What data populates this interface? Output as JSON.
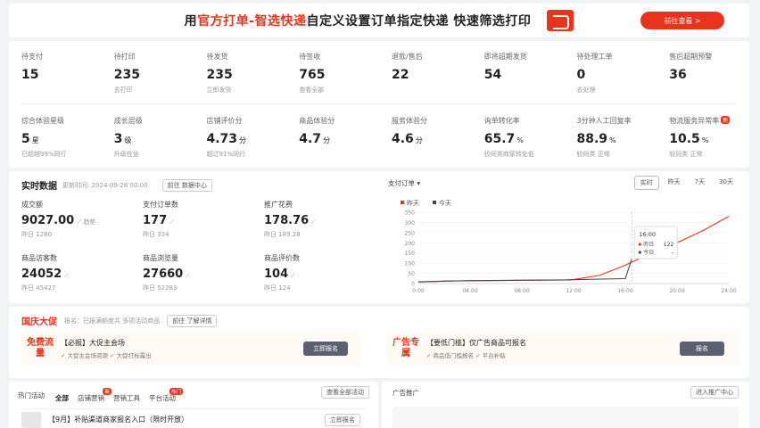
{
  "banner": {
    "part1": "用",
    "part2": "官方打单-智选快递",
    "part3": "自定义设置订单指定快递 快速筛选打印",
    "button": "前往查看 >"
  },
  "orders": [
    {
      "label": "待支付",
      "value": "15",
      "sub": ""
    },
    {
      "label": "待打印",
      "value": "235",
      "sub": "去打印"
    },
    {
      "label": "待发货",
      "value": "235",
      "sub": "立即发货"
    },
    {
      "label": "待签收",
      "value": "765",
      "sub": "查看全部"
    },
    {
      "label": "退款/售后",
      "value": "22",
      "sub": ""
    },
    {
      "label": "即将超期发货",
      "value": "54",
      "sub": ""
    },
    {
      "label": "待处理工单",
      "value": "0",
      "sub": "去处理"
    },
    {
      "label": "售后超期预警",
      "value": "36",
      "sub": ""
    }
  ],
  "scores": [
    {
      "label": "综合体验星级",
      "value": "5",
      "unit": "星",
      "sub": "已超越99%同行",
      "badge": ""
    },
    {
      "label": "成长层级",
      "value": "3",
      "unit": "级",
      "sub": "升级在途",
      "badge": ""
    },
    {
      "label": "店铺评价分",
      "value": "4.73",
      "unit": "分",
      "sub": "超过91%同行",
      "badge": ""
    },
    {
      "label": "商品体验分",
      "value": "4.7",
      "unit": "分",
      "sub": "",
      "badge": ""
    },
    {
      "label": "服务体验分",
      "value": "4.6",
      "unit": "分",
      "sub": "",
      "badge": ""
    },
    {
      "label": "询单转化率",
      "value": "65.7",
      "unit": "%",
      "sub": "较同类商家转化低",
      "badge": ""
    },
    {
      "label": "3分钟人工回复率",
      "value": "88.9",
      "unit": "%",
      "sub": "较同类 正常",
      "badge": ""
    },
    {
      "label": "物流服务异常率",
      "value": "10.5",
      "unit": "%",
      "sub": "较同类 正常",
      "badge": "新"
    }
  ],
  "realtime": {
    "title": "实时数据",
    "updated": "更新时间: 2024-09-28 00:00",
    "export_btn": "前往 数据中心",
    "metrics": [
      {
        "label": "成交额",
        "value": "9027.00",
        "trend": "趋势",
        "sub": "昨日 1280"
      },
      {
        "label": "支付订单数",
        "value": "177",
        "trend": "",
        "sub": "昨日 334"
      },
      {
        "label": "推广花费",
        "value": "178.76",
        "trend": "",
        "sub": "昨日 189.28"
      },
      {
        "label": "商品访客数",
        "value": "24052",
        "trend": "",
        "sub": "昨日 45427"
      },
      {
        "label": "商品浏览量",
        "value": "27660",
        "trend": "",
        "sub": "昨日 52283"
      },
      {
        "label": "商品评价数",
        "value": "104",
        "trend": "",
        "sub": "昨日 124"
      }
    ]
  },
  "chart_select": "支付订单",
  "range_tabs": [
    "实时",
    "昨天",
    "7天",
    "30天"
  ],
  "chart_data": {
    "type": "line",
    "x_ticks": [
      "0:00",
      "04:00",
      "08:00",
      "12:00",
      "16:00",
      "20:00",
      "24:00"
    ],
    "y_ticks": [
      "350",
      "300",
      "250",
      "200",
      "150",
      "100",
      "50",
      "0"
    ],
    "ylim": [
      0,
      350
    ],
    "series": [
      {
        "name": "昨天",
        "color": "#e8341c",
        "points": [
          [
            0,
            8
          ],
          [
            2,
            12
          ],
          [
            4,
            14
          ],
          [
            6,
            15
          ],
          [
            8,
            16
          ],
          [
            10,
            17
          ],
          [
            11.5,
            18
          ],
          [
            12,
            20
          ],
          [
            14,
            40
          ],
          [
            16,
            90
          ],
          [
            18,
            150
          ],
          [
            20,
            200
          ],
          [
            22,
            260
          ],
          [
            24,
            330
          ]
        ]
      },
      {
        "name": "今天",
        "color": "#444444",
        "points": [
          [
            0,
            8
          ],
          [
            2,
            12
          ],
          [
            4,
            14
          ],
          [
            6,
            15
          ],
          [
            8,
            16
          ],
          [
            10,
            17
          ],
          [
            11.5,
            18
          ],
          [
            12,
            19
          ],
          [
            14,
            22
          ],
          [
            16,
            24
          ],
          [
            16.5,
            122
          ]
        ]
      }
    ],
    "tooltip": {
      "title": "16:00",
      "rows": [
        {
          "name": "昨日",
          "value": "122"
        },
        {
          "name": "今日",
          "value": "-"
        }
      ]
    }
  },
  "activity": {
    "title": "国庆大促",
    "desc": "报名：已报满额度共 多项活动商品",
    "link": "前往 了解详情",
    "items": [
      {
        "tag": "免费流量",
        "head": "【必报】大促主会场",
        "sub": "✓ 大促主会场资源    ✓ 大促打标露出",
        "btn": "立即报名"
      },
      {
        "tag": "广告专属",
        "head": "【要低门槛】仅广告商品可报名",
        "sub": "✓ 商品低门槛报名    ✓ 平台补贴",
        "btn": "报名"
      }
    ]
  },
  "bottom": {
    "title": "热门活动",
    "tabs": [
      {
        "label": "全部",
        "badge": ""
      },
      {
        "label": "店铺营销",
        "badge": "新"
      },
      {
        "label": "营销工具",
        "badge": ""
      },
      {
        "label": "平台活动",
        "badge": "热门"
      }
    ],
    "more": "查看全部活动",
    "item": "【9月】补贴渠道商家报名入口（限时开放）",
    "item_btn": "立即报名",
    "ad_title": "广告推广",
    "ad_btn": "进入推广中心"
  }
}
